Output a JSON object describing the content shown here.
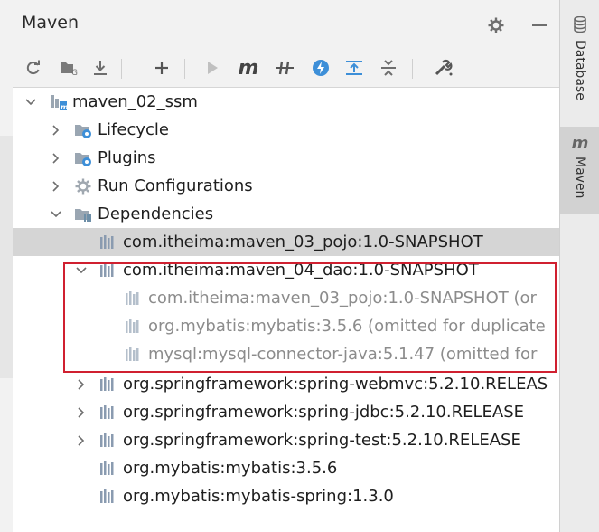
{
  "header": {
    "title": "Maven"
  },
  "toolbar": {
    "buttons": [
      {
        "name": "reload-icon"
      },
      {
        "name": "generate-sources-icon"
      },
      {
        "name": "download-icon"
      },
      {
        "name": "add-icon"
      },
      {
        "name": "run-icon"
      },
      {
        "name": "execute-goal-icon"
      },
      {
        "name": "toggle-offline-icon"
      },
      {
        "name": "skip-tests-icon"
      },
      {
        "name": "show-dependencies-icon"
      },
      {
        "name": "collapse-all-icon"
      },
      {
        "name": "settings-wrench-icon"
      }
    ]
  },
  "tree": {
    "project": "maven_02_ssm",
    "lifecycle": "Lifecycle",
    "plugins": "Plugins",
    "run_configurations": "Run Configurations",
    "dependencies": "Dependencies",
    "deps": [
      "com.itheima:maven_03_pojo:1.0-SNAPSHOT",
      "com.itheima:maven_04_dao:1.0-SNAPSHOT",
      "com.itheima:maven_03_pojo:1.0-SNAPSHOT (or",
      "org.mybatis:mybatis:3.5.6 (omitted for duplicate",
      "mysql:mysql-connector-java:5.1.47 (omitted for",
      "org.springframework:spring-webmvc:5.2.10.RELEAS",
      "org.springframework:spring-jdbc:5.2.10.RELEASE",
      "org.springframework:spring-test:5.2.10.RELEASE",
      "org.mybatis:mybatis:3.5.6",
      "org.mybatis:mybatis-spring:1.3.0"
    ]
  },
  "sidebar": {
    "database": "Database",
    "maven": "Maven"
  },
  "colors": {
    "accent": "#3d8fd8",
    "highlight": "#d02030",
    "selected": "#d5d5d5"
  }
}
